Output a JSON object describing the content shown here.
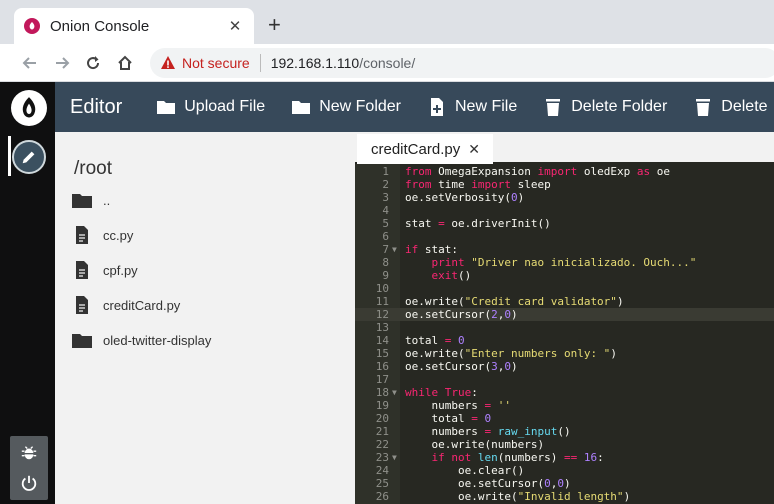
{
  "browser": {
    "tab_title": "Onion Console",
    "tab_close": "✕",
    "new_tab": "+",
    "security_label": "Not secure",
    "url_host": "192.168.1.110",
    "url_path": "/console/"
  },
  "app": {
    "header_title": "Editor",
    "buttons": [
      "Upload File",
      "New Folder",
      "New File",
      "Delete Folder",
      "Delete"
    ]
  },
  "files": {
    "root": "/root",
    "items": [
      {
        "name": "..",
        "type": "folder"
      },
      {
        "name": "cc.py",
        "type": "file"
      },
      {
        "name": "cpf.py",
        "type": "file"
      },
      {
        "name": "creditCard.py",
        "type": "file"
      },
      {
        "name": "oled-twitter-display",
        "type": "folder"
      }
    ]
  },
  "editor": {
    "open_tab": "creditCard.py",
    "close_glyph": "✕",
    "active_line": 12,
    "lines": [
      "from OmegaExpansion import oledExp as oe",
      "from time import sleep",
      "oe.setVerbosity(0)",
      "",
      "stat = oe.driverInit()",
      "",
      "if stat:",
      "    print \"Driver nao inicializado. Ouch...\"",
      "    exit()",
      "",
      "oe.write(\"Credit card validator\")",
      "oe.setCursor(2,0)",
      "",
      "total = 0",
      "oe.write(\"Enter numbers only: \")",
      "oe.setCursor(3,0)",
      "",
      "while True:",
      "    numbers = ''",
      "    total = 0",
      "    numbers = raw_input()",
      "    oe.write(numbers)",
      "    if not len(numbers) == 16:",
      "        oe.clear()",
      "        oe.setCursor(0,0)",
      "        oe.write(\"Invalid length\")"
    ],
    "fold_lines": [
      7,
      18,
      23
    ]
  },
  "colors": {
    "header_bg": "#37495a",
    "sidebar_bg": "#0f0f10",
    "editor_bg": "#272822",
    "keyword": "#f92672",
    "string": "#e6db74",
    "number": "#ae81ff",
    "warning": "#c5221f"
  }
}
